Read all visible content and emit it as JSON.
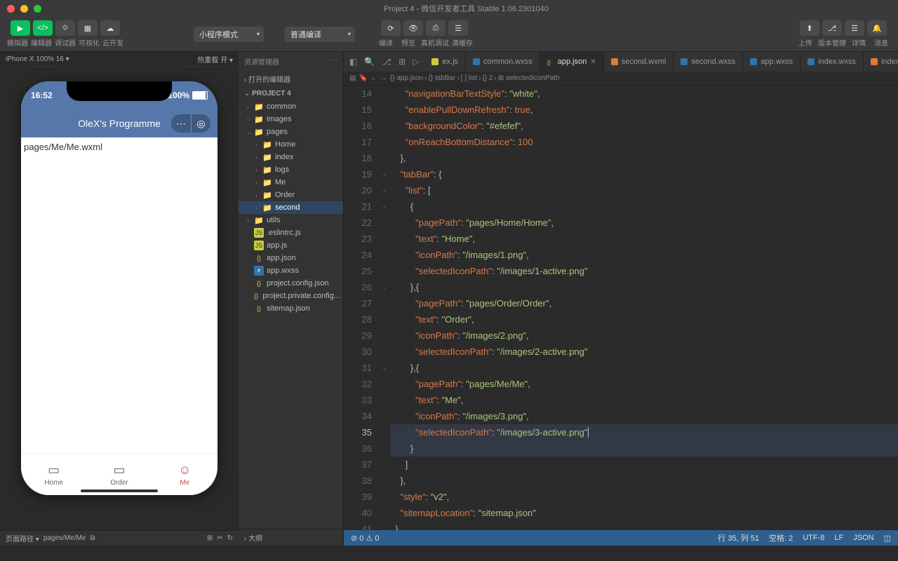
{
  "titlebar": {
    "title": "Project 4 - 微信开发者工具 Stable 1.06.2301040"
  },
  "toolbar": {
    "compile": "编译",
    "grp1_labels": [
      "模拟器",
      "编辑器",
      "调试器",
      "可视化",
      "云开发"
    ],
    "mode": "小程序模式",
    "compile_dd": "普通编译",
    "grp2_labels": [
      "编译",
      "预览",
      "真机调试",
      "清缓存"
    ],
    "right_labels": [
      "上传",
      "版本管理",
      "详情",
      "消息"
    ]
  },
  "simbar": {
    "device": "iPhone X 100% 16 ▾",
    "hot": "热重载 开 ▾"
  },
  "phone": {
    "time": "16:52",
    "battery": "100%",
    "title": "OleX's Programme",
    "body": "pages/Me/Me.wxml",
    "tabs": [
      "Home",
      "Order",
      "Me"
    ]
  },
  "sidebar": {
    "header": "资源管理器",
    "open_editors": "打开的编辑器",
    "project": "PROJECT 4",
    "tree": [
      {
        "d": 1,
        "t": "folder",
        "n": "common",
        "a": "›"
      },
      {
        "d": 1,
        "t": "folder",
        "n": "images",
        "a": "›"
      },
      {
        "d": 1,
        "t": "folder",
        "n": "pages",
        "a": "⌄"
      },
      {
        "d": 2,
        "t": "folder",
        "n": "Home",
        "a": "›"
      },
      {
        "d": 2,
        "t": "folder",
        "n": "index",
        "a": "›"
      },
      {
        "d": 2,
        "t": "folder",
        "n": "logs",
        "a": "›"
      },
      {
        "d": 2,
        "t": "folder",
        "n": "Me",
        "a": "›"
      },
      {
        "d": 2,
        "t": "folder",
        "n": "Order",
        "a": "›"
      },
      {
        "d": 2,
        "t": "folder",
        "n": "second",
        "a": "›",
        "sel": true
      },
      {
        "d": 1,
        "t": "folder",
        "n": "utils",
        "a": "›"
      },
      {
        "d": 1,
        "t": "js",
        "n": ".eslintrc.js"
      },
      {
        "d": 1,
        "t": "js",
        "n": "app.js"
      },
      {
        "d": 1,
        "t": "json",
        "n": "app.json"
      },
      {
        "d": 1,
        "t": "wxss",
        "n": "app.wxss"
      },
      {
        "d": 1,
        "t": "json",
        "n": "project.config.json"
      },
      {
        "d": 1,
        "t": "json",
        "n": "project.private.config..."
      },
      {
        "d": 1,
        "t": "json",
        "n": "sitemap.json"
      }
    ],
    "outline": "大纲"
  },
  "tabs": [
    {
      "ico": "js",
      "label": "ex.js"
    },
    {
      "ico": "css",
      "label": "common.wxss"
    },
    {
      "ico": "json",
      "label": "app.json",
      "active": true,
      "close": true
    },
    {
      "ico": "wxml",
      "label": "second.wxml"
    },
    {
      "ico": "css",
      "label": "second.wxss"
    },
    {
      "ico": "css",
      "label": "app.wxss"
    },
    {
      "ico": "css",
      "label": "index.wxss"
    },
    {
      "ico": "wxml",
      "label": "index.wxml"
    }
  ],
  "crumb": [
    "{} app.json",
    "{} tabBar",
    "[ ] list",
    "{} 2",
    "⊞ selectedIconPath"
  ],
  "code": {
    "start": 14,
    "current": 35,
    "lines": [
      {
        "i": 3,
        "seg": [
          [
            "key",
            "\"navigationBarTextStyle\""
          ],
          [
            "punc",
            ": "
          ],
          [
            "val",
            "\"white\""
          ],
          [
            "punc",
            ","
          ]
        ]
      },
      {
        "i": 3,
        "seg": [
          [
            "key",
            "\"enablePullDownRefresh\""
          ],
          [
            "punc",
            ": "
          ],
          [
            "bool",
            "true"
          ],
          [
            "punc",
            ","
          ]
        ]
      },
      {
        "i": 3,
        "seg": [
          [
            "key",
            "\"backgroundColor\""
          ],
          [
            "punc",
            ": "
          ],
          [
            "val",
            "\"#efefef\""
          ],
          [
            "punc",
            ","
          ]
        ]
      },
      {
        "i": 3,
        "seg": [
          [
            "key",
            "\"onReachBottomDistance\""
          ],
          [
            "punc",
            ": "
          ],
          [
            "num",
            "100"
          ]
        ]
      },
      {
        "i": 2,
        "seg": [
          [
            "punc",
            "},"
          ]
        ]
      },
      {
        "i": 2,
        "seg": [
          [
            "key",
            "\"tabBar\""
          ],
          [
            "punc",
            ": "
          ],
          [
            "punc",
            "{"
          ]
        ]
      },
      {
        "i": 3,
        "seg": [
          [
            "key",
            "\"list\""
          ],
          [
            "punc",
            ": "
          ],
          [
            "punc",
            "["
          ]
        ]
      },
      {
        "i": 4,
        "seg": [
          [
            "punc",
            "{"
          ]
        ]
      },
      {
        "i": 5,
        "seg": [
          [
            "key",
            "\"pagePath\""
          ],
          [
            "punc",
            ": "
          ],
          [
            "val",
            "\"pages/Home/Home\""
          ],
          [
            "punc",
            ","
          ]
        ]
      },
      {
        "i": 5,
        "seg": [
          [
            "key",
            "\"text\""
          ],
          [
            "punc",
            ": "
          ],
          [
            "val",
            "\"Home\""
          ],
          [
            "punc",
            ","
          ]
        ]
      },
      {
        "i": 5,
        "seg": [
          [
            "key",
            "\"iconPath\""
          ],
          [
            "punc",
            ": "
          ],
          [
            "val",
            "\"/images/1.png\""
          ],
          [
            "punc",
            ","
          ]
        ]
      },
      {
        "i": 5,
        "seg": [
          [
            "key",
            "\"selectedIconPath\""
          ],
          [
            "punc",
            ": "
          ],
          [
            "val",
            "\"/images/1-active.png\""
          ]
        ]
      },
      {
        "i": 4,
        "seg": [
          [
            "punc",
            "},{"
          ]
        ]
      },
      {
        "i": 5,
        "seg": [
          [
            "key",
            "\"pagePath\""
          ],
          [
            "punc",
            ": "
          ],
          [
            "val",
            "\"pages/Order/Order\""
          ],
          [
            "punc",
            ","
          ]
        ]
      },
      {
        "i": 5,
        "seg": [
          [
            "key",
            "\"text\""
          ],
          [
            "punc",
            ": "
          ],
          [
            "val",
            "\"Order\""
          ],
          [
            "punc",
            ","
          ]
        ]
      },
      {
        "i": 5,
        "seg": [
          [
            "key",
            "\"iconPath\""
          ],
          [
            "punc",
            ": "
          ],
          [
            "val",
            "\"/images/2.png\""
          ],
          [
            "punc",
            ","
          ]
        ]
      },
      {
        "i": 5,
        "seg": [
          [
            "key",
            "\"selectedIconPath\""
          ],
          [
            "punc",
            ": "
          ],
          [
            "val",
            "\"/images/2-active.png\""
          ]
        ]
      },
      {
        "i": 4,
        "seg": [
          [
            "punc",
            "},{"
          ]
        ]
      },
      {
        "i": 5,
        "seg": [
          [
            "key",
            "\"pagePath\""
          ],
          [
            "punc",
            ": "
          ],
          [
            "val",
            "\"pages/Me/Me\""
          ],
          [
            "punc",
            ","
          ]
        ]
      },
      {
        "i": 5,
        "seg": [
          [
            "key",
            "\"text\""
          ],
          [
            "punc",
            ": "
          ],
          [
            "val",
            "\"Me\""
          ],
          [
            "punc",
            ","
          ]
        ]
      },
      {
        "i": 5,
        "seg": [
          [
            "key",
            "\"iconPath\""
          ],
          [
            "punc",
            ": "
          ],
          [
            "val",
            "\"/images/3.png\""
          ],
          [
            "punc",
            ","
          ]
        ]
      },
      {
        "i": 5,
        "seg": [
          [
            "key",
            "\"selectedIconPath\""
          ],
          [
            "punc",
            ": "
          ],
          [
            "val",
            "\"/images/3-active.png\""
          ]
        ],
        "hl": true,
        "cursor": true
      },
      {
        "i": 4,
        "seg": [
          [
            "punc",
            "}"
          ]
        ],
        "hl": true
      },
      {
        "i": 3,
        "seg": [
          [
            "punc",
            "]"
          ]
        ]
      },
      {
        "i": 2,
        "seg": [
          [
            "punc",
            "},"
          ]
        ]
      },
      {
        "i": 2,
        "seg": [
          [
            "key",
            "\"style\""
          ],
          [
            "punc",
            ": "
          ],
          [
            "val",
            "\"v2\""
          ],
          [
            "punc",
            ","
          ]
        ]
      },
      {
        "i": 2,
        "seg": [
          [
            "key",
            "\"sitemapLocation\""
          ],
          [
            "punc",
            ": "
          ],
          [
            "val",
            "\"sitemap.json\""
          ]
        ]
      },
      {
        "i": 1,
        "seg": [
          [
            "punc",
            "}"
          ]
        ]
      }
    ]
  },
  "pathbar": {
    "label": "页面路径 ▾",
    "value": "pages/Me/Me"
  },
  "status": {
    "left": [
      "⊘ 0 ⚠ 0"
    ],
    "right": [
      "行 35, 列 51",
      "空格: 2",
      "UTF-8",
      "LF",
      "JSON",
      "◫"
    ]
  }
}
